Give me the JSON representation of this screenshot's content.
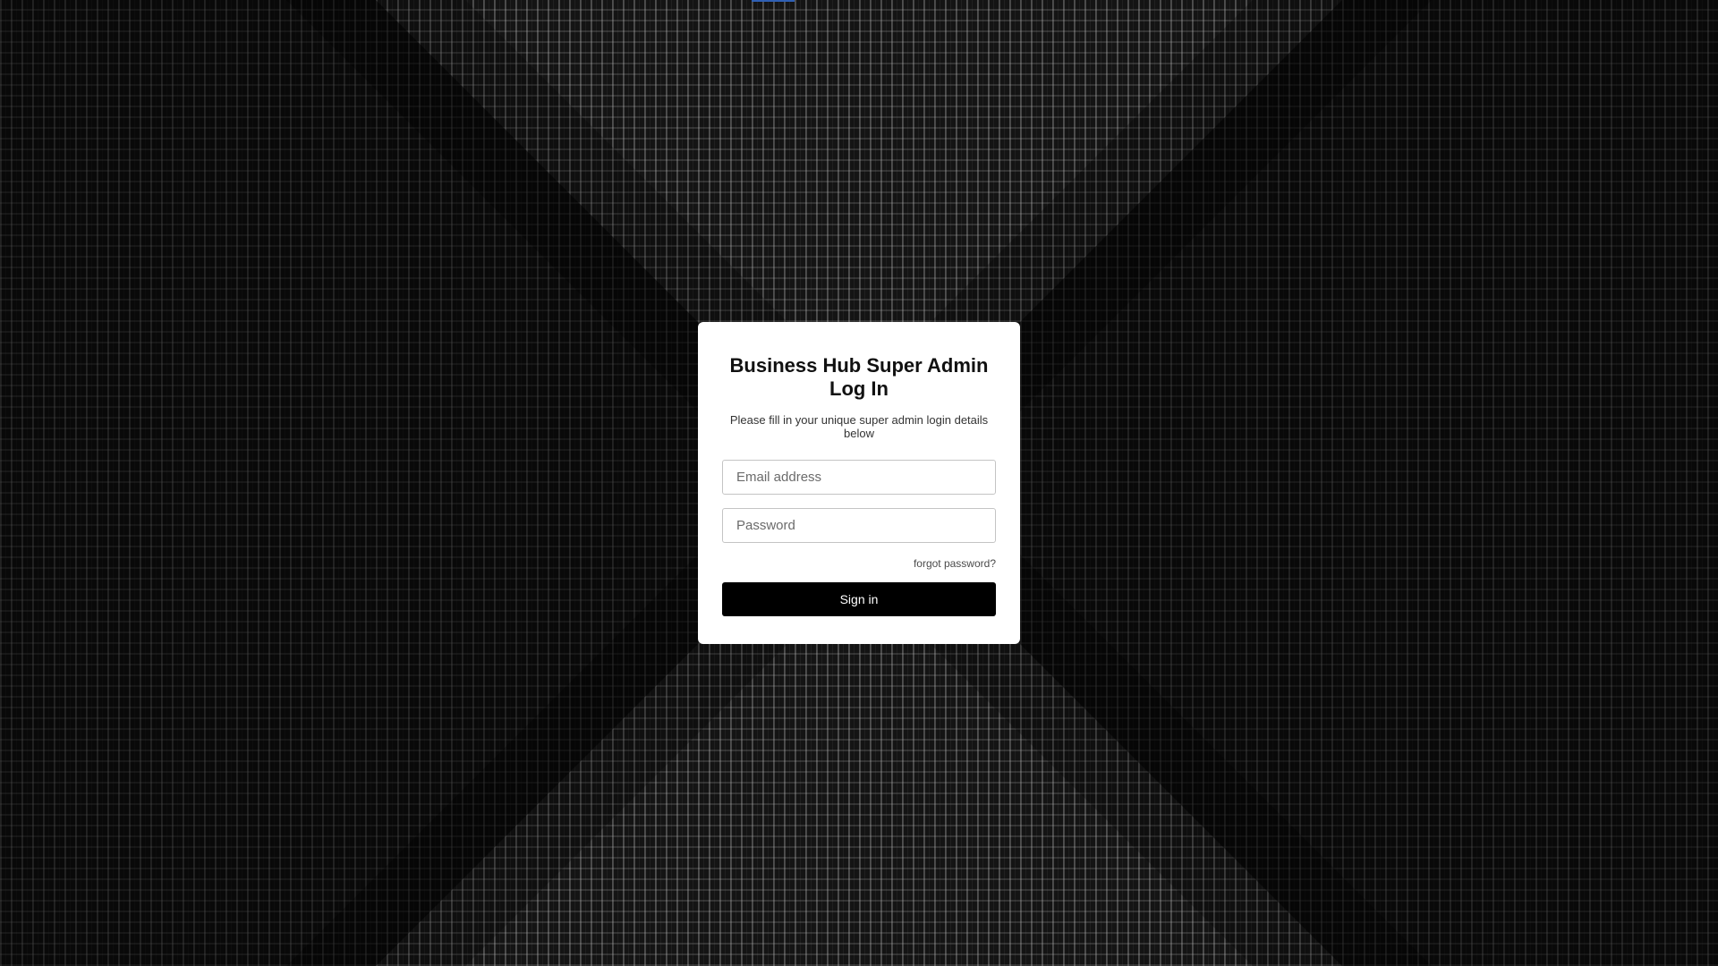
{
  "login": {
    "title": "Business Hub Super Admin Log In",
    "subtitle": "Please fill in your unique super admin login details below",
    "email_placeholder": "Email address",
    "password_placeholder": "Password",
    "forgot_label": "forgot password?",
    "signin_label": "Sign in"
  },
  "colors": {
    "background": "#141414",
    "card": "#ffffff",
    "button": "#000000",
    "button_text": "#ffffff",
    "top_accent": "#2f5fb3"
  }
}
